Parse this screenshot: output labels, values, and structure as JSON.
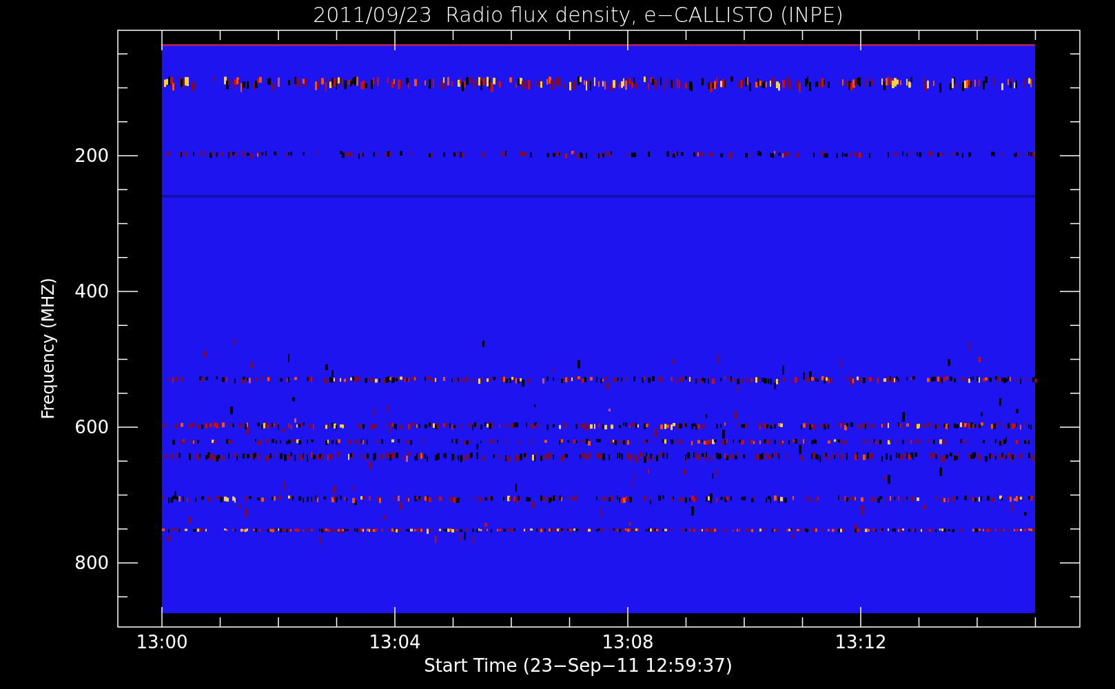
{
  "title": "2011/09/23  Radio flux density, e−CALLISTO (INPE)",
  "y_axis": {
    "label": "Frequency (MHZ)",
    "ticks": [
      "200",
      "400",
      "600",
      "800"
    ]
  },
  "x_axis": {
    "label": "Start Time (23−Sep−11 12:59:37)",
    "ticks": [
      "13:00",
      "13:04",
      "13:08",
      "13:12"
    ]
  }
}
